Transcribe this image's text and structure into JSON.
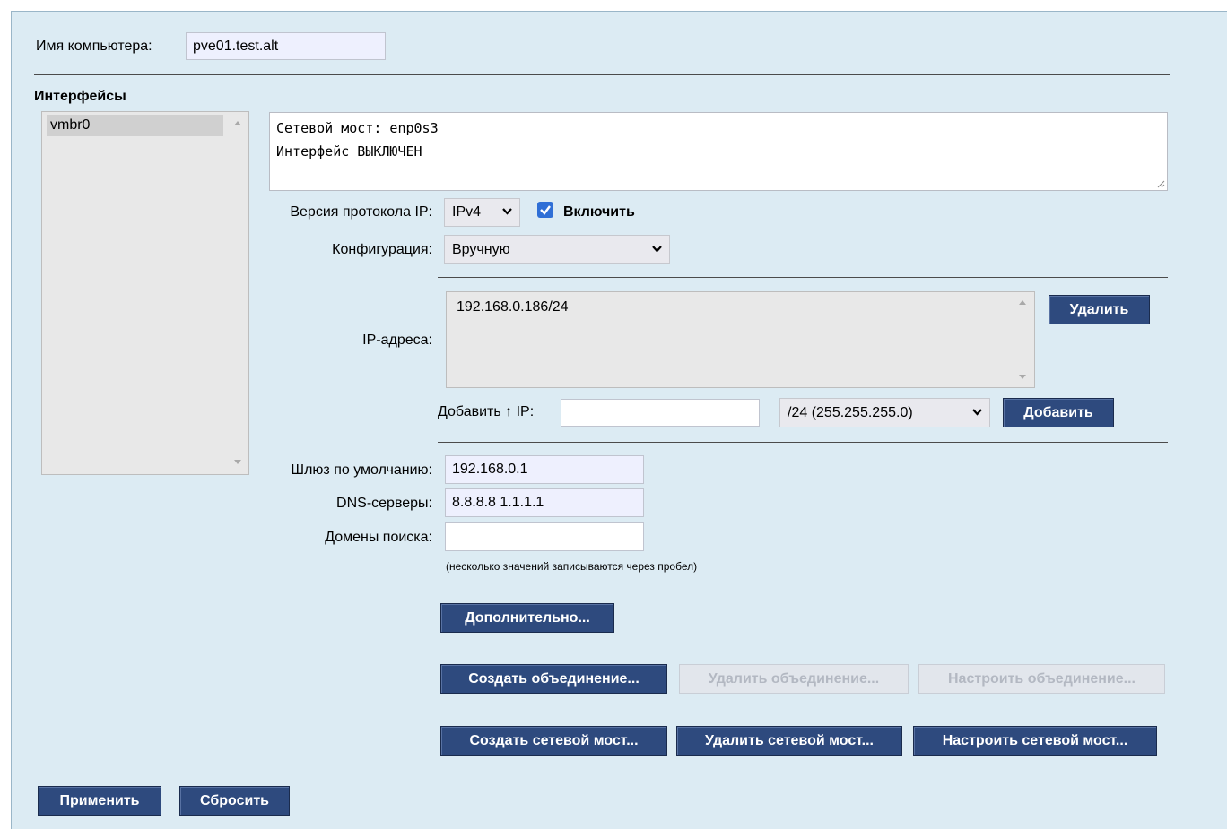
{
  "hostname": {
    "label": "Имя компьютера:",
    "value": "pve01.test.alt"
  },
  "interfaces": {
    "heading": "Интерфейсы",
    "items": [
      "vmbr0"
    ]
  },
  "info": {
    "line1": "Сетевой мост: enp0s3",
    "line2": "Интерфейс ВЫКЛЮЧЕН"
  },
  "ip_version": {
    "label": "Версия протокола IP:",
    "value": "IPv4"
  },
  "enable": {
    "label": "Включить",
    "checked": true
  },
  "configuration": {
    "label": "Конфигурация:",
    "value": "Вручную"
  },
  "ip_addresses": {
    "label": "IP-адреса:",
    "items": [
      "192.168.0.186/24"
    ],
    "delete_label": "Удалить"
  },
  "add_ip": {
    "label": "Добавить ↑ IP:",
    "value": "",
    "mask": "/24 (255.255.255.0)",
    "add_label": "Добавить"
  },
  "gateway": {
    "label": "Шлюз по умолчанию:",
    "value": "192.168.0.1"
  },
  "dns": {
    "label": "DNS-серверы:",
    "value": "8.8.8.8 1.1.1.1"
  },
  "search_domains": {
    "label": "Домены поиска:",
    "value": ""
  },
  "hint": "(несколько значений записываются через пробел)",
  "buttons": {
    "advanced": "Дополнительно...",
    "create_bond": "Создать объединение...",
    "delete_bond": "Удалить объединение...",
    "configure_bond": "Настроить объединение...",
    "create_bridge": "Создать сетевой мост...",
    "delete_bridge": "Удалить сетевой мост...",
    "configure_bridge": "Настроить сетевой мост...",
    "apply": "Применить",
    "reset": "Сбросить"
  },
  "colors": {
    "panel_bg": "#dcebf3",
    "button_bg": "#2e4a7e",
    "input_bg": "#eef0fe",
    "checkbox": "#2f6fd6"
  }
}
